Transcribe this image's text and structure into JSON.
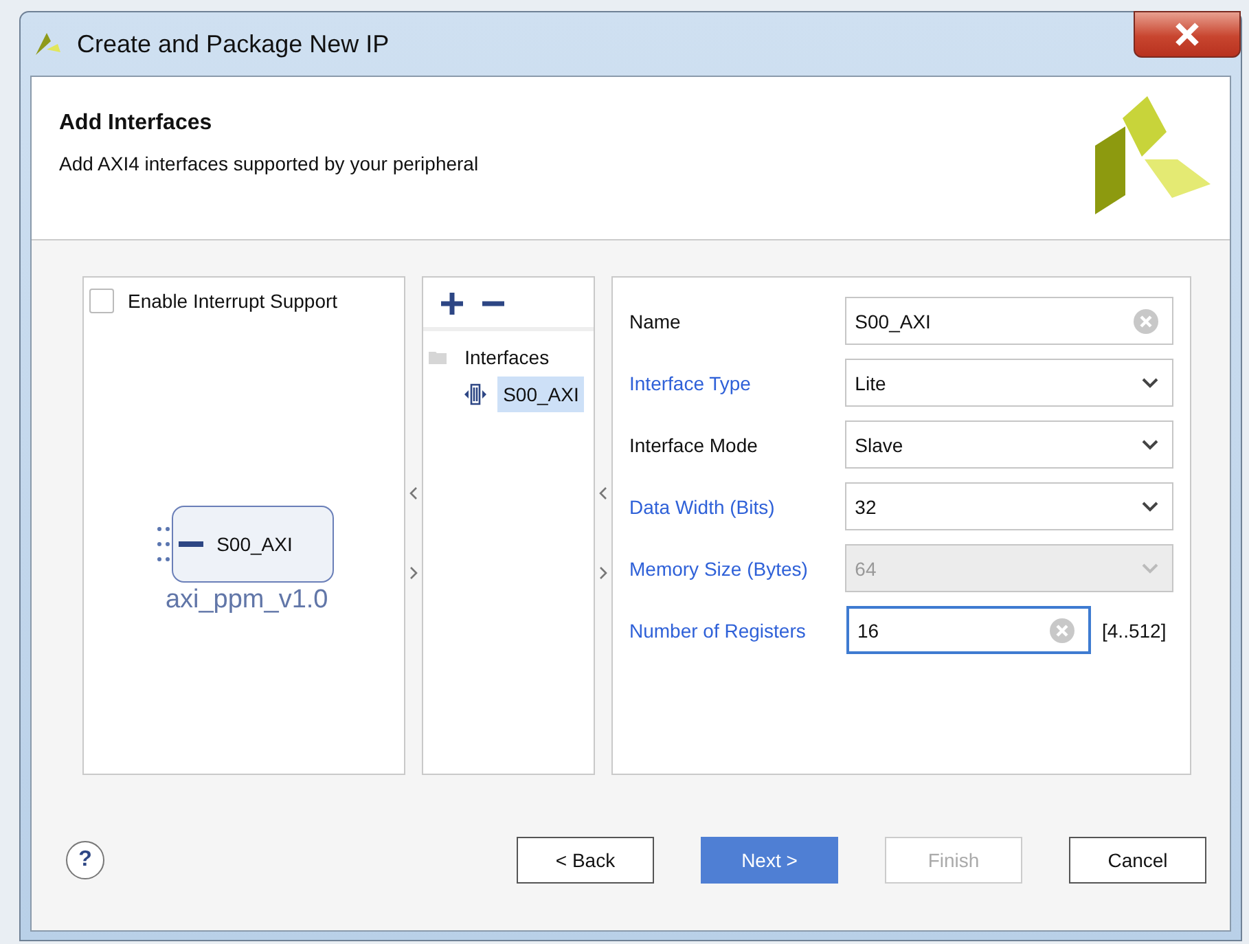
{
  "window": {
    "title": "Create and Package New IP"
  },
  "header": {
    "title": "Add Interfaces",
    "subtitle": "Add AXI4 interfaces supported by your peripheral"
  },
  "interrupt": {
    "label": "Enable Interrupt Support",
    "checked": false
  },
  "block": {
    "port": "S00_AXI",
    "name": "axi_ppm_v1.0"
  },
  "tree": {
    "label": "Interfaces",
    "expanded": true,
    "children": [
      {
        "label": "S00_AXI",
        "selected": true
      }
    ]
  },
  "fields": [
    {
      "kind": "text",
      "label": "Name",
      "linked": false,
      "value": "S00_AXI",
      "focused": false
    },
    {
      "kind": "dropdown",
      "label": "Interface Type",
      "linked": true,
      "value": "Lite",
      "disabled": false
    },
    {
      "kind": "dropdown",
      "label": "Interface Mode",
      "linked": false,
      "value": "Slave",
      "disabled": false
    },
    {
      "kind": "dropdown",
      "label": "Data Width (Bits)",
      "linked": true,
      "value": "32",
      "disabled": false
    },
    {
      "kind": "dropdown",
      "label": "Memory Size (Bytes)",
      "linked": true,
      "value": "64",
      "disabled": true
    },
    {
      "kind": "text",
      "label": "Number of Registers",
      "linked": true,
      "value": "16",
      "focused": true,
      "range": "[4..512]"
    }
  ],
  "help": "?",
  "buttons": [
    {
      "label": "< Back",
      "kind": "default"
    },
    {
      "label": "Next >",
      "kind": "primary"
    },
    {
      "label": "Finish",
      "kind": "disabled"
    },
    {
      "label": "Cancel",
      "kind": "default"
    }
  ]
}
